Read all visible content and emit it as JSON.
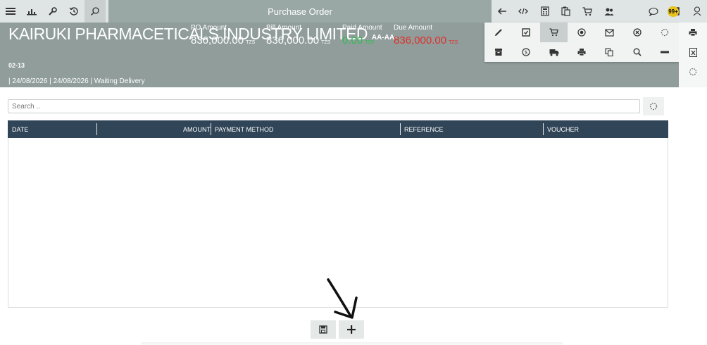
{
  "window": {
    "title": "Purchase Order"
  },
  "toolbar_left": [
    {
      "name": "menu-icon"
    },
    {
      "name": "chart-icon"
    },
    {
      "name": "wrench-icon"
    },
    {
      "name": "history-icon"
    },
    {
      "name": "search-icon"
    }
  ],
  "toolbar_right": [
    {
      "name": "back-arrow-icon"
    },
    {
      "name": "code-icon"
    },
    {
      "name": "calculator-icon"
    },
    {
      "name": "clipboard-icon"
    },
    {
      "name": "cart-icon"
    },
    {
      "name": "users-icon"
    },
    {
      "name": "chat-icon"
    },
    {
      "name": "mail-icon"
    },
    {
      "name": "user-icon"
    }
  ],
  "notifications": {
    "badge": "99+"
  },
  "document": {
    "company": "KAIRUKI PHARMACETICALS INDUSTRY LIMITED",
    "company_code": "AA-AA-",
    "doc_code": "02-13",
    "meta": "| 24/08/2026 | 24/08/2026 | Waiting Delivery"
  },
  "amounts": {
    "po": {
      "label": "PO Amount",
      "value": "836,000.00",
      "currency": "TZS"
    },
    "bill": {
      "label": "Bill Amount",
      "value": "836,000.00",
      "currency": "TZS"
    },
    "paid": {
      "label": "Paid Amount",
      "value": "0.00",
      "currency": "TZS"
    },
    "due": {
      "label": "Due Amount",
      "value": "836,000.00",
      "currency": "TZS"
    }
  },
  "actions_panel": [
    [
      "pencil-icon",
      "check-square-icon",
      "cart-icon",
      "record-icon",
      "envelope-icon",
      "cancel-circle-icon",
      "spinner-icon"
    ],
    [
      "archive-icon",
      "dollar-icon",
      "truck-icon",
      "print-icon",
      "copy-icon",
      "search-icon",
      "minus-icon"
    ]
  ],
  "side_actions": [
    "print-icon",
    "excel-icon",
    "spinner-icon"
  ],
  "search": {
    "placeholder": "Search .."
  },
  "table": {
    "columns": [
      "DATE",
      "AMOUNT",
      "PAYMENT METHOD",
      "REFERENCE",
      "VOUCHER"
    ]
  },
  "bottom_buttons": [
    "save-icon",
    "plus-icon"
  ],
  "colors": {
    "header_bg": "#909d9b",
    "table_header_bg": "#304557",
    "paid_color": "#2dbb4f",
    "due_color": "#e0302a",
    "badge_color": "#e9c21c"
  }
}
